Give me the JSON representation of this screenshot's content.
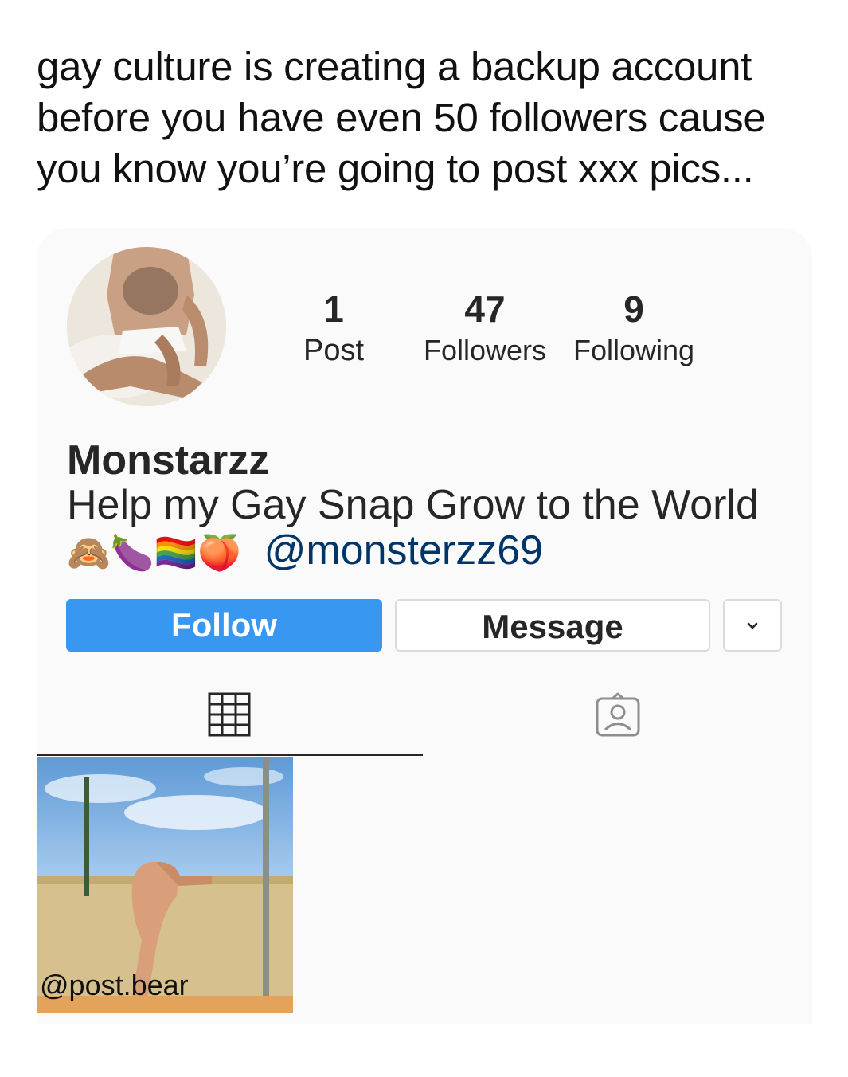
{
  "meme_caption": "gay culture is creating a backup account before you have even 50 followers cause you know you’re going to post xxx pics...",
  "profile": {
    "stats": [
      {
        "value": "1",
        "label": "Post"
      },
      {
        "value": "47",
        "label": "Followers"
      },
      {
        "value": "9",
        "label": "Following"
      }
    ],
    "username": "Monstarzz",
    "bio_text": "Help my Gay Snap Grow to the World",
    "bio_emojis": "🙈🍆🏳️‍🌈🍑",
    "bio_mention": "@monsterzz69"
  },
  "actions": {
    "follow_label": "Follow",
    "message_label": "Message",
    "more_icon": "chevron-down-icon"
  },
  "tabs": [
    {
      "icon": "grid-icon",
      "active": true
    },
    {
      "icon": "tagged-icon",
      "active": false
    }
  ],
  "posts": [
    {
      "overlay_text": "@post.bear"
    }
  ],
  "colors": {
    "follow_button": "#3897f0",
    "mention": "#003569",
    "card_bg": "#fafafa"
  }
}
